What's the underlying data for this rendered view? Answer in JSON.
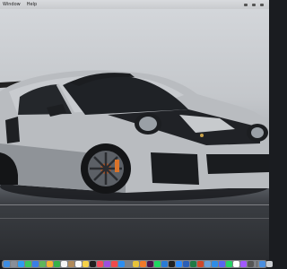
{
  "menubar": {
    "items": [
      "Window",
      "Help"
    ]
  },
  "dock": {
    "icons": [
      {
        "name": "finder-icon",
        "color": "#3d8de3"
      },
      {
        "name": "launchpad-icon",
        "color": "#8a8f98"
      },
      {
        "name": "safari-icon",
        "color": "#2f9cf0"
      },
      {
        "name": "messages-icon",
        "color": "#3bc55a"
      },
      {
        "name": "mail-icon",
        "color": "#3a7ee6"
      },
      {
        "name": "maps-icon",
        "color": "#5fb65c"
      },
      {
        "name": "photos-icon",
        "color": "#f2b233"
      },
      {
        "name": "facetime-icon",
        "color": "#34b24a"
      },
      {
        "name": "calendar-icon",
        "color": "#f4f4f4"
      },
      {
        "name": "contacts-icon",
        "color": "#b08a5a"
      },
      {
        "name": "reminders-icon",
        "color": "#f7f7f7"
      },
      {
        "name": "notes-icon",
        "color": "#f5d24a"
      },
      {
        "name": "tv-icon",
        "color": "#1f1f1f"
      },
      {
        "name": "music-icon",
        "color": "#f24b5d"
      },
      {
        "name": "podcasts-icon",
        "color": "#9b4fe0"
      },
      {
        "name": "news-icon",
        "color": "#f04a4a"
      },
      {
        "name": "app-store-icon",
        "color": "#2d8ef0"
      },
      {
        "name": "system-preferences-icon",
        "color": "#7d8188"
      },
      {
        "name": "chrome-icon",
        "color": "#e8c33a"
      },
      {
        "name": "firefox-icon",
        "color": "#f07a2a"
      },
      {
        "name": "slack-icon",
        "color": "#4a154b"
      },
      {
        "name": "spotify-icon",
        "color": "#1ed760"
      },
      {
        "name": "vscode-icon",
        "color": "#2a7bd6"
      },
      {
        "name": "terminal-icon",
        "color": "#222222"
      },
      {
        "name": "zoom-icon",
        "color": "#2d8cff"
      },
      {
        "name": "word-icon",
        "color": "#2b5fb8"
      },
      {
        "name": "excel-icon",
        "color": "#1f7a45"
      },
      {
        "name": "powerpoint-icon",
        "color": "#d0482a"
      },
      {
        "name": "preview-icon",
        "color": "#6aa0d8"
      },
      {
        "name": "xcode-icon",
        "color": "#2f8de6"
      },
      {
        "name": "discord-icon",
        "color": "#5865f2"
      },
      {
        "name": "whatsapp-icon",
        "color": "#25d366"
      },
      {
        "name": "notion-icon",
        "color": "#ffffff"
      },
      {
        "name": "figma-icon",
        "color": "#a259ff"
      },
      {
        "name": "calculator-icon",
        "color": "#555555"
      }
    ],
    "trailing_icons": [
      {
        "name": "downloads-icon",
        "color": "#4a8fe0"
      },
      {
        "name": "trash-icon",
        "color": "#c9ccd1"
      }
    ]
  }
}
